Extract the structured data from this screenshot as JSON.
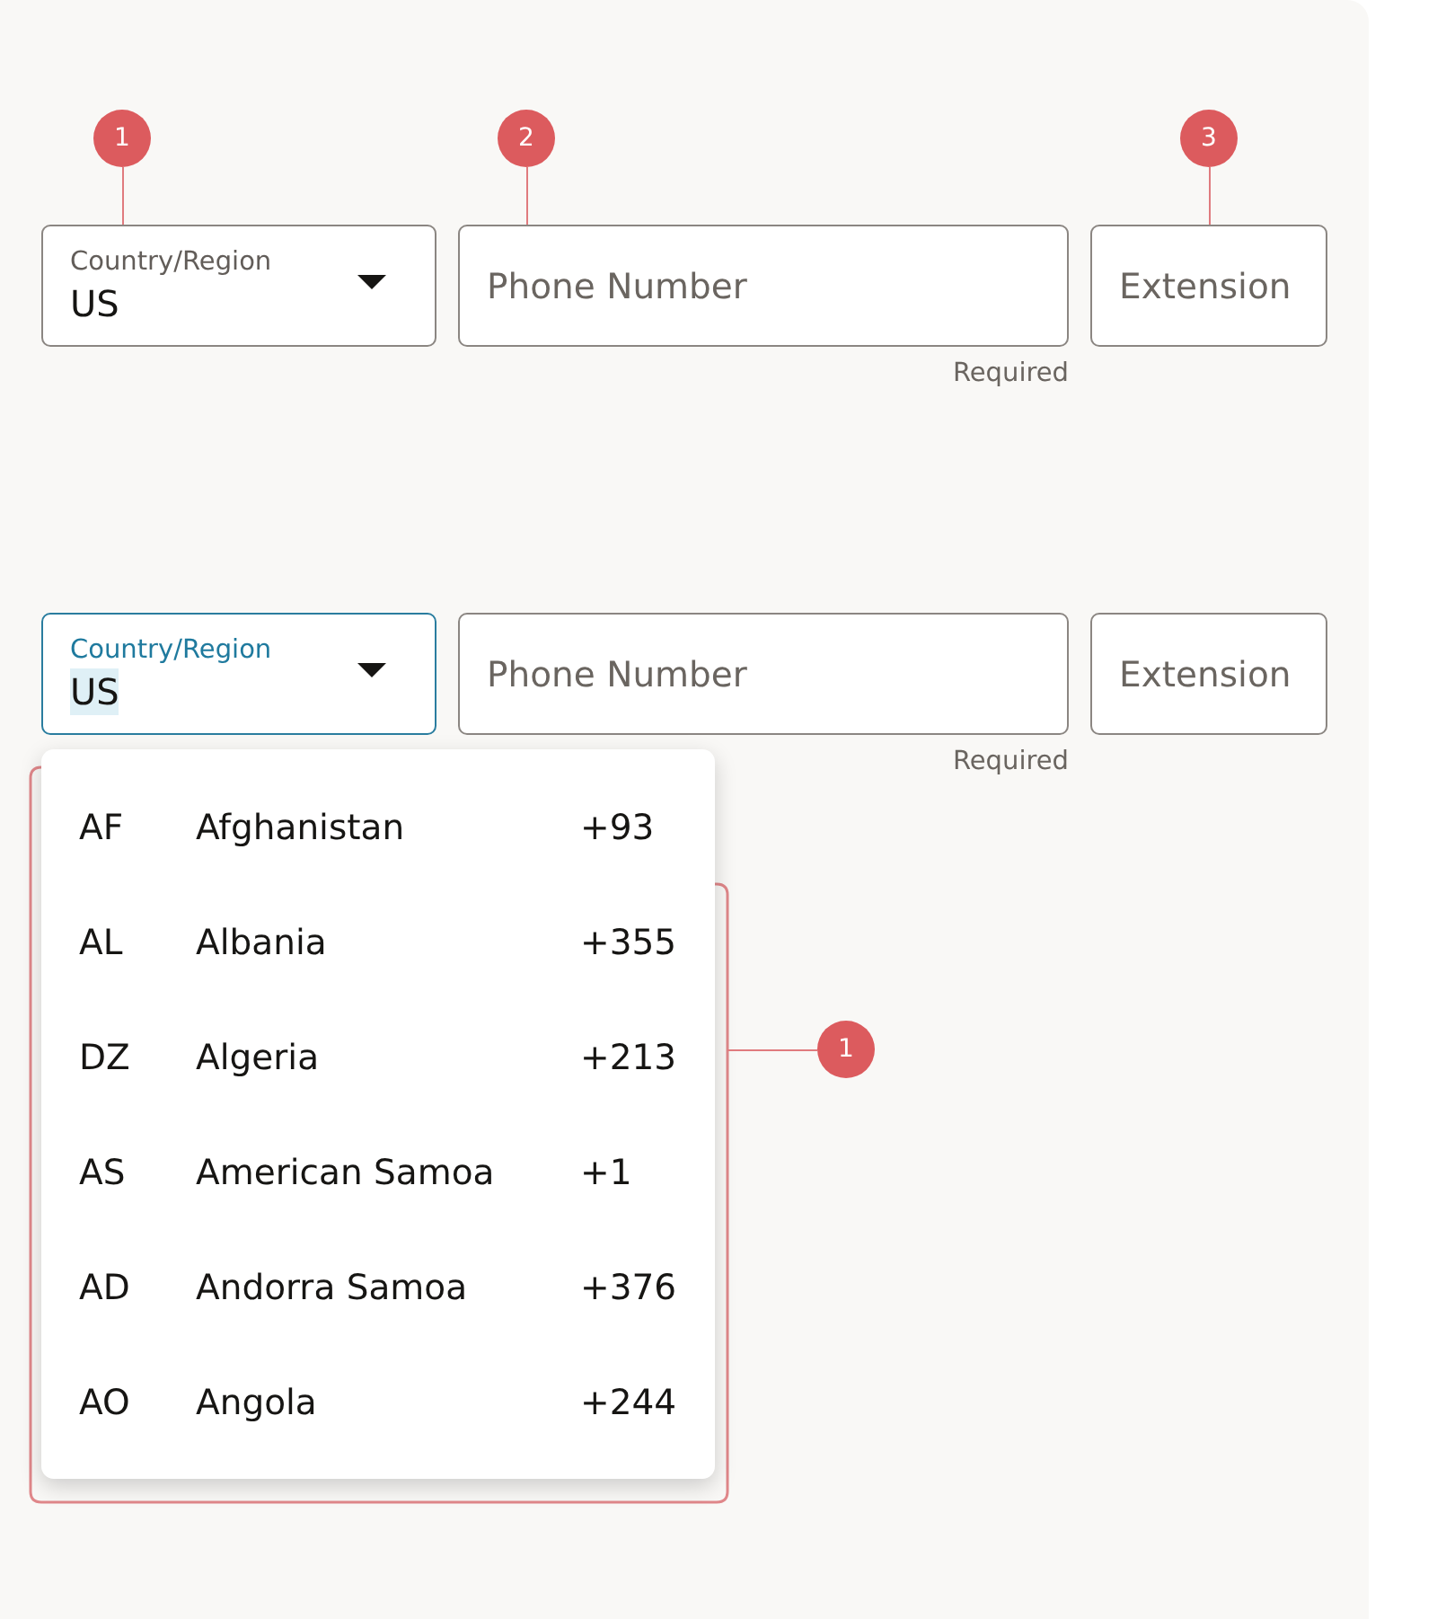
{
  "form_examples": [
    {
      "fields": [
        {
          "kind": "select",
          "label": "Country/Region",
          "value": "US",
          "focused": false,
          "text_selected": false,
          "callout": "1"
        },
        {
          "kind": "text",
          "placeholder": "Phone Number",
          "helper": "Required",
          "callout": "2"
        },
        {
          "kind": "text",
          "placeholder": "Extension",
          "callout": "3"
        }
      ]
    },
    {
      "fields": [
        {
          "kind": "select",
          "label": "Country/Region",
          "value": "US",
          "focused": true,
          "text_selected": true
        },
        {
          "kind": "text",
          "placeholder": "Phone Number",
          "helper": "Required"
        },
        {
          "kind": "text",
          "placeholder": "Extension"
        }
      ],
      "dropdown": {
        "callout": "1",
        "options": [
          {
            "code": "AF",
            "name": "Afghanistan",
            "dial_code": "+93",
            "selected": false
          },
          {
            "code": "AL",
            "name": "Albania",
            "dial_code": "+355",
            "selected": false
          },
          {
            "code": "DZ",
            "name": "Algeria",
            "dial_code": "+213",
            "selected": false
          },
          {
            "code": "AS",
            "name": "American Samoa",
            "dial_code": "+1",
            "selected": false
          },
          {
            "code": "AD",
            "name": "Andorra Samoa",
            "dial_code": "+376",
            "selected": false
          },
          {
            "code": "AO",
            "name": "Angola",
            "dial_code": "+244",
            "selected": false
          }
        ]
      }
    }
  ]
}
